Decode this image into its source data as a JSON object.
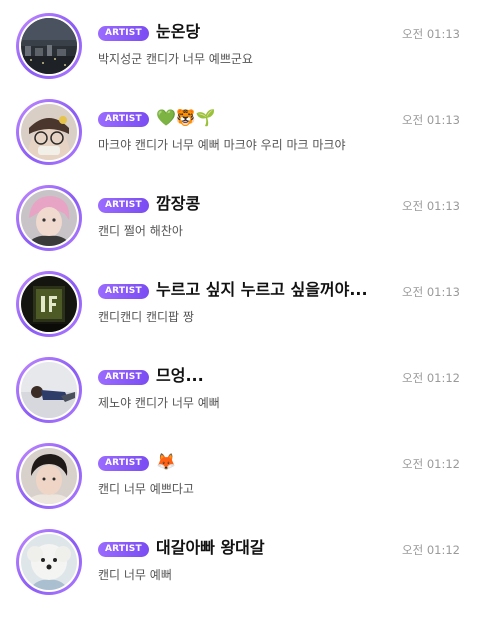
{
  "chats": [
    {
      "badge": "ARTIST",
      "name": "눈온당",
      "time": "오전 01:13",
      "message": "박지성군 캔디가 너무 예쁘군요"
    },
    {
      "badge": "ARTIST",
      "name": "💚🐯🌱",
      "time": "오전 01:13",
      "message": "마크야 캔디가 너무 예뻐 마크야 우리 마크 마크야"
    },
    {
      "badge": "ARTIST",
      "name": "깜장콩",
      "time": "오전 01:13",
      "message": "캔디 쩔어 해찬아"
    },
    {
      "badge": "ARTIST",
      "name": "누르고 싶지 누르고 싶을꺼야...",
      "time": "오전 01:13",
      "message": "캔디캔디 캔디팝 짱"
    },
    {
      "badge": "ARTIST",
      "name": "므엉...",
      "time": "오전 01:12",
      "message": "제노야 캔디가 너무 예뻐"
    },
    {
      "badge": "ARTIST",
      "name": "🦊",
      "time": "오전 01:12",
      "message": "캔디 너무 예쁘다고"
    },
    {
      "badge": "ARTIST",
      "name": "대갈아빠 왕대갈",
      "time": "오전 01:12",
      "message": "캔디 너무 예뻐"
    }
  ],
  "colors": {
    "badge_gradient_start": "#9b6bff",
    "badge_gradient_end": "#7a4cf2",
    "ring": "#8a5cf6",
    "time": "#9a9a9a",
    "message": "#555555"
  }
}
